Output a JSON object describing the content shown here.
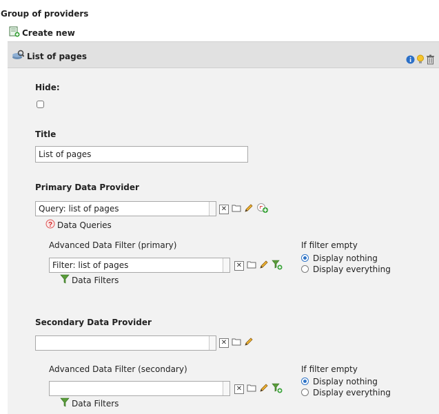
{
  "page": {
    "group_title": "Group of providers",
    "create_new": "Create new"
  },
  "record": {
    "header_title": "List of pages",
    "actions": [
      "info-icon",
      "lightbulb-icon",
      "trash-icon"
    ]
  },
  "fields": {
    "hide": {
      "label": "Hide:",
      "checked": false
    },
    "title": {
      "label": "Title",
      "value": "List of pages"
    },
    "primary": {
      "label": "Primary Data Provider",
      "value": "Query: list of pages",
      "link": "Data Queries",
      "filter": {
        "label": "Advanced Data Filter (primary)",
        "value": "Filter: list of pages",
        "link": "Data Filters",
        "empty_label": "If filter empty",
        "option_nothing": "Display nothing",
        "option_everything": "Display everything",
        "selected": "Display nothing"
      }
    },
    "secondary": {
      "label": "Secondary Data Provider",
      "value": "",
      "filter": {
        "label": "Advanced Data Filter (secondary)",
        "value": "",
        "link": "Data Filters",
        "empty_label": "If filter empty",
        "option_nothing": "Display nothing",
        "option_everything": "Display everything",
        "selected": "Display nothing"
      }
    }
  },
  "controls": {
    "remove_symbol": "✕"
  },
  "colors": {
    "panel_bg": "#f2f2f2",
    "header_bg": "#e1e1e1",
    "radio_accent": "#2f74c7"
  }
}
